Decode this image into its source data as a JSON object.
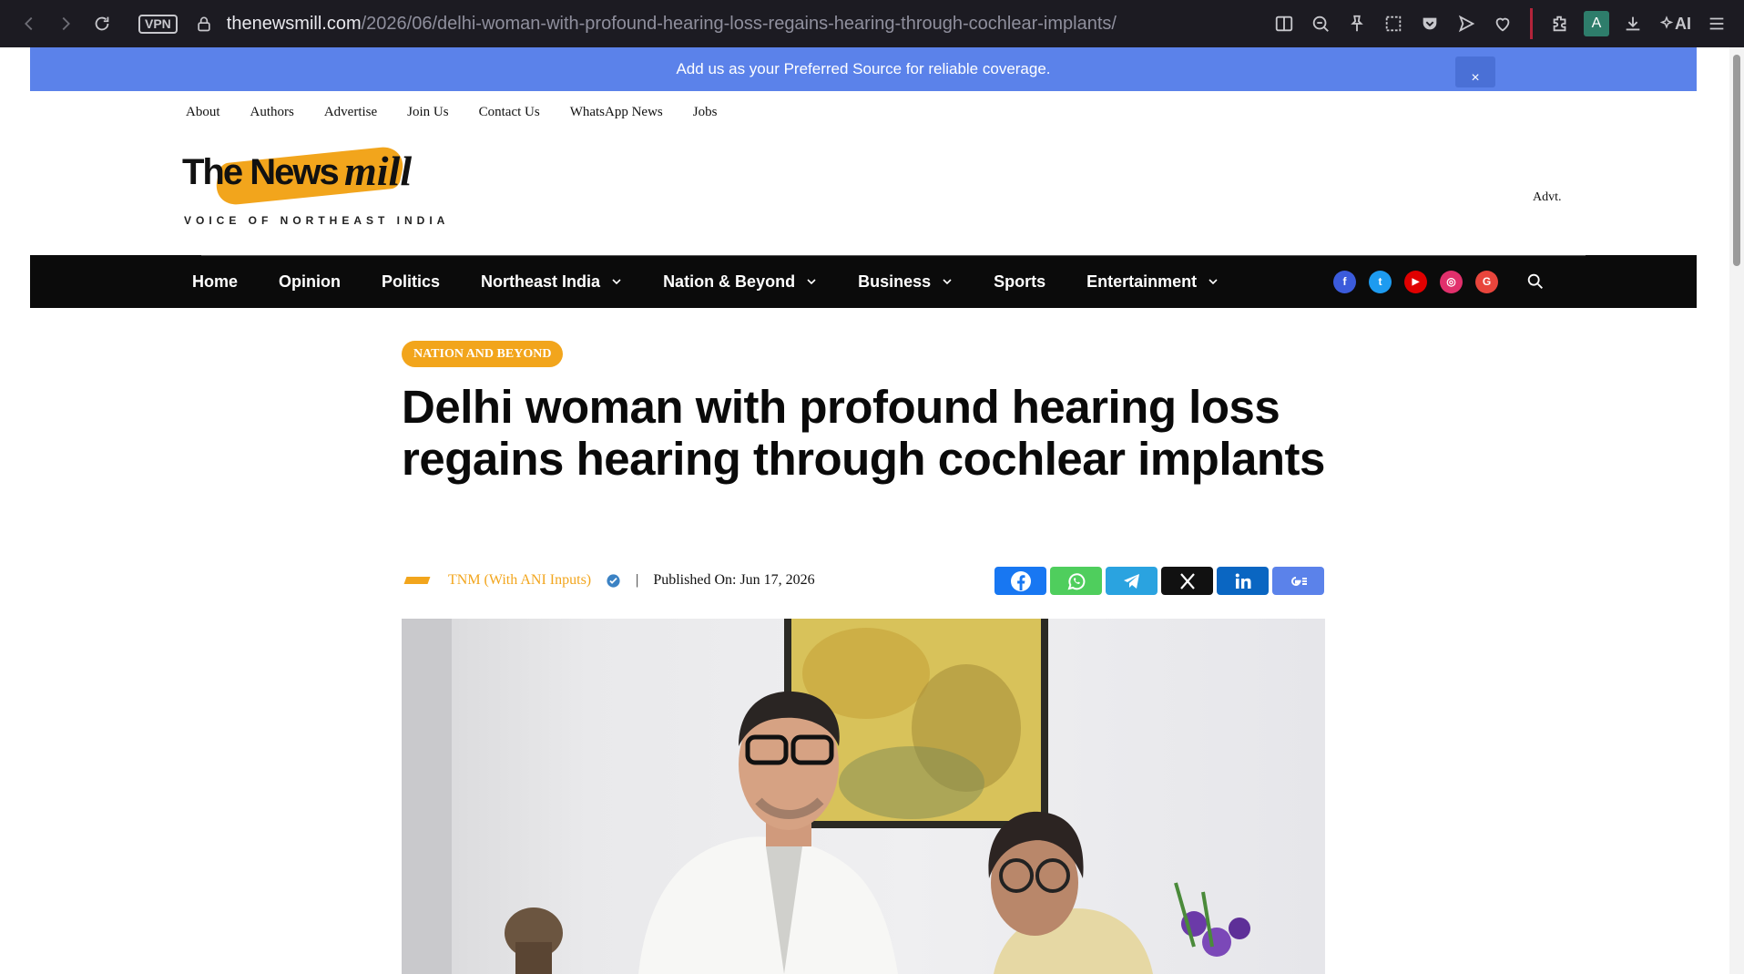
{
  "browser": {
    "vpn_label": "VPN",
    "url_host": "thenewsmill.com",
    "url_path": "/2026/06/delhi-woman-with-profound-hearing-loss-regains-hearing-through-cochlear-implants/",
    "profile_letter": "A",
    "ai_label": "AI"
  },
  "banner": {
    "text": "Add us as your Preferred Source for reliable coverage.",
    "close_label": "×"
  },
  "top_links": [
    "About",
    "Authors",
    "Advertise",
    "Join Us",
    "Contact Us",
    "WhatsApp News",
    "Jobs"
  ],
  "logo": {
    "brand_main": "The News",
    "brand_script": "mill",
    "tagline": "VOICE OF NORTHEAST INDIA"
  },
  "advt_label": "Advt.",
  "main_nav": [
    {
      "label": "Home",
      "dropdown": false
    },
    {
      "label": "Opinion",
      "dropdown": false
    },
    {
      "label": "Politics",
      "dropdown": false
    },
    {
      "label": "Northeast India",
      "dropdown": true
    },
    {
      "label": "Nation & Beyond",
      "dropdown": true
    },
    {
      "label": "Business",
      "dropdown": true
    },
    {
      "label": "Sports",
      "dropdown": false
    },
    {
      "label": "Entertainment",
      "dropdown": true
    }
  ],
  "social_icons": [
    {
      "name": "facebook-icon",
      "color": "#3b5bdb",
      "glyph": "f"
    },
    {
      "name": "twitter-icon",
      "color": "#1d9bf0",
      "glyph": "t"
    },
    {
      "name": "youtube-icon",
      "color": "#e00000",
      "glyph": "▶"
    },
    {
      "name": "instagram-icon",
      "color": "#e1306c",
      "glyph": "◎"
    },
    {
      "name": "google-icon",
      "color": "#e8453c",
      "glyph": "G"
    }
  ],
  "article": {
    "category": "NATION AND BEYOND",
    "headline": "Delhi woman with profound hearing loss regains hearing through cochlear implants",
    "author": "TNM (With ANI Inputs)",
    "separator": "|",
    "published": "Published On: Jun 17, 2026"
  },
  "share_buttons": [
    {
      "name": "share-facebook-button",
      "color": "#1877f2"
    },
    {
      "name": "share-whatsapp-button",
      "color": "#4fce5d"
    },
    {
      "name": "share-telegram-button",
      "color": "#2aa3e0"
    },
    {
      "name": "share-x-button",
      "color": "#111111"
    },
    {
      "name": "share-linkedin-button",
      "color": "#0a66c2"
    },
    {
      "name": "share-google-news-button",
      "color": "#5b82ea"
    }
  ],
  "colors": {
    "accent": "#f2a51c",
    "banner": "#5b82ea",
    "nav_bg": "#0b0b0b"
  }
}
